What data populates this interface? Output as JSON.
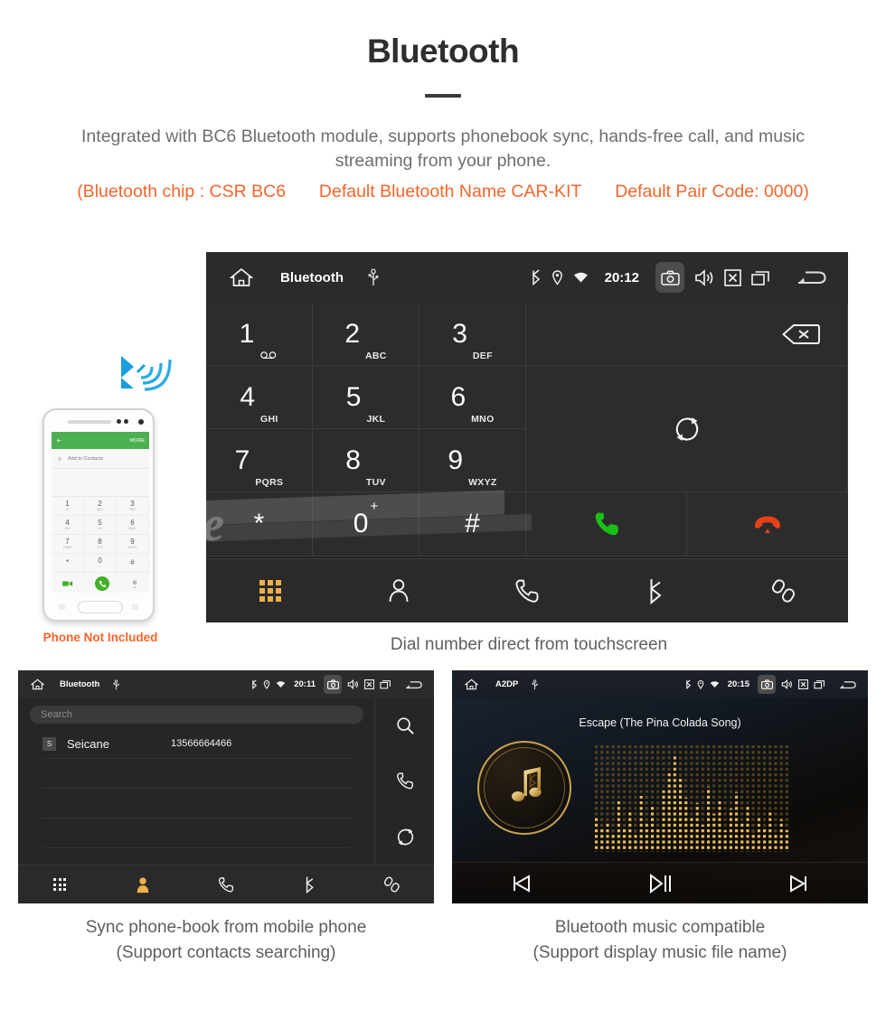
{
  "header": {
    "title": "Bluetooth",
    "intro": "Integrated with BC6 Bluetooth module, supports phonebook sync, hands-free call, and music streaming from your phone.",
    "spec_chip": "(Bluetooth chip : CSR BC6",
    "spec_name": "Default Bluetooth Name CAR-KIT",
    "spec_pair": "Default Pair Code: 0000)"
  },
  "colors": {
    "accent_orange": "#f4652a",
    "active_nav": "#f0b04a",
    "call_green": "#18c018",
    "end_red": "#e8401a",
    "bluetooth_blue": "#1ba1e2",
    "gold": "#c8a34e",
    "screen_bg": "#262626"
  },
  "dialer": {
    "topbar": {
      "title": "Bluetooth",
      "clock": "20:12",
      "icons": [
        "home-icon",
        "usb-icon",
        "bluetooth-icon",
        "location-icon",
        "wifi-icon",
        "camera-icon",
        "volume-icon",
        "close-icon",
        "recents-icon",
        "back-icon"
      ]
    },
    "keys": [
      {
        "digit": "1",
        "sub": "",
        "icon": "voicemail-icon"
      },
      {
        "digit": "2",
        "sub": "ABC"
      },
      {
        "digit": "3",
        "sub": "DEF"
      },
      {
        "digit": "4",
        "sub": "GHI"
      },
      {
        "digit": "5",
        "sub": "JKL"
      },
      {
        "digit": "6",
        "sub": "MNO"
      },
      {
        "digit": "7",
        "sub": "PQRS"
      },
      {
        "digit": "8",
        "sub": "TUV"
      },
      {
        "digit": "9",
        "sub": "WXYZ"
      },
      {
        "digit": "*",
        "sub": ""
      },
      {
        "digit": "0",
        "sup": "+"
      },
      {
        "digit": "#",
        "sub": ""
      }
    ],
    "actions": {
      "backspace": "backspace-icon",
      "sync": "sync-icon",
      "call": "call-icon",
      "end_call": "end-call-icon"
    },
    "nav": [
      {
        "name": "dialpad",
        "icon": "dialpad-icon",
        "active": true
      },
      {
        "name": "contacts",
        "icon": "contact-icon",
        "active": false
      },
      {
        "name": "call-log",
        "icon": "phone-icon",
        "active": false
      },
      {
        "name": "bluetooth",
        "icon": "bluetooth-icon",
        "active": false
      },
      {
        "name": "pair",
        "icon": "link-icon",
        "active": false
      }
    ],
    "watermark": "Seicane",
    "caption": "Dial number direct from touchscreen"
  },
  "phone_mock": {
    "header_more": "MORE",
    "add_contact": "Add to Contacts",
    "keys": [
      {
        "d": "1",
        "s": "oo"
      },
      {
        "d": "2",
        "s": "ABC"
      },
      {
        "d": "3",
        "s": "DEF"
      },
      {
        "d": "4",
        "s": "GHI"
      },
      {
        "d": "5",
        "s": "JKL"
      },
      {
        "d": "6",
        "s": "MNO"
      },
      {
        "d": "7",
        "s": "PQRS"
      },
      {
        "d": "8",
        "s": "TUV"
      },
      {
        "d": "9",
        "s": "WXYZ"
      },
      {
        "d": "*",
        "s": ""
      },
      {
        "d": "0",
        "s": "+"
      },
      {
        "d": "#",
        "s": ""
      }
    ],
    "note": "Phone Not Included"
  },
  "phonebook": {
    "topbar": {
      "title": "Bluetooth",
      "clock": "20:11"
    },
    "search_placeholder": "Search",
    "contacts": [
      {
        "initial": "S",
        "name": "Seicane",
        "number": "13566664466"
      }
    ],
    "side_actions": [
      "search-icon",
      "call-icon",
      "sync-icon"
    ],
    "nav": [
      {
        "name": "dialpad",
        "icon": "dialpad-icon",
        "active": false
      },
      {
        "name": "contacts",
        "icon": "contact-icon",
        "active": true
      },
      {
        "name": "call-log",
        "icon": "phone-icon",
        "active": false
      },
      {
        "name": "bluetooth",
        "icon": "bluetooth-icon",
        "active": false
      },
      {
        "name": "pair",
        "icon": "link-icon",
        "active": false
      }
    ],
    "caption_line1": "Sync phone-book from mobile phone",
    "caption_line2": "(Support contacts searching)"
  },
  "music": {
    "topbar": {
      "title": "A2DP",
      "clock": "20:15"
    },
    "song_title": "Escape (The Pina Colada Song)",
    "album_icon": "bluetooth-music-icon",
    "visualizer": "dot-matrix-equalizer",
    "controls": [
      "previous-track-icon",
      "play-pause-icon",
      "next-track-icon"
    ],
    "caption_line1": "Bluetooth music compatible",
    "caption_line2": "(Support display music file name)"
  }
}
